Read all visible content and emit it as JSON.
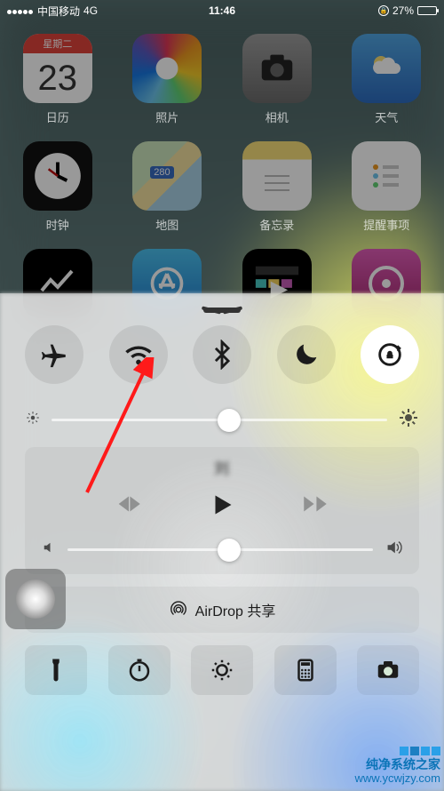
{
  "statusbar": {
    "carrier": "中国移动",
    "network": "4G",
    "time": "11:46",
    "battery_pct": "27%",
    "rotation_locked": true
  },
  "apps": {
    "calendar": {
      "label": "日历",
      "day_name": "星期二",
      "date": "23"
    },
    "photos": {
      "label": "照片"
    },
    "camera": {
      "label": "相机"
    },
    "weather": {
      "label": "天气"
    },
    "clock": {
      "label": "时钟"
    },
    "maps": {
      "label": "地图"
    },
    "notes": {
      "label": "备忘录"
    },
    "reminders": {
      "label": "提醒事项"
    },
    "stocks": {
      "label": ""
    },
    "appstore": {
      "label": ""
    },
    "imovie": {
      "label": ""
    },
    "itunes": {
      "label": ""
    }
  },
  "control_center": {
    "toggles": {
      "airplane": {
        "active": false
      },
      "wifi": {
        "active": false
      },
      "bluetooth": {
        "active": false
      },
      "dnd": {
        "active": false
      },
      "rotation": {
        "active": true
      }
    },
    "brightness_pct": 53,
    "music": {
      "track": "刘",
      "volume_pct": 53
    },
    "airdrop_label": "AirDrop 共享"
  },
  "annotation": {
    "arrow_target": "wifi-toggle"
  },
  "watermark": {
    "name": "纯净系统之家",
    "url": "www.ycwjzy.com"
  }
}
